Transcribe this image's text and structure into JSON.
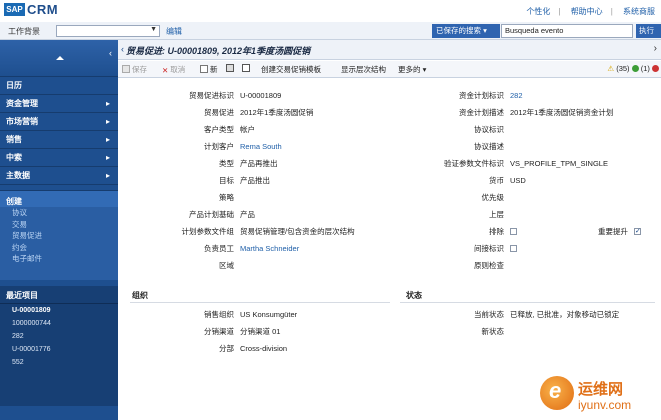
{
  "app": {
    "logo": "SAP",
    "name": "CRM"
  },
  "top_links": [
    "个性化",
    "帮助中心",
    "系统商服"
  ],
  "work_context": {
    "label": "工作背景",
    "value": "",
    "edit": "编辑"
  },
  "saved_search": {
    "label": "已保存的搜索",
    "value": "Busqueda evento",
    "execute": "执行"
  },
  "sidebar": {
    "nav": [
      {
        "label": "日历",
        "arrow": ""
      },
      {
        "label": "资金管理",
        "arrow": "▸"
      },
      {
        "label": "市场营销",
        "arrow": "▸"
      },
      {
        "label": "销售",
        "arrow": "▸"
      },
      {
        "label": "中索",
        "arrow": "▸"
      },
      {
        "label": "主数据",
        "arrow": "▸"
      }
    ],
    "create": {
      "header": "创建",
      "links": [
        "协议",
        "交易",
        "贸易促进",
        "约会",
        "电子邮件"
      ]
    },
    "recent": {
      "header": "最近项目",
      "items": [
        "U-00001809",
        "1000000744",
        "282",
        "U-00001776",
        "552"
      ]
    }
  },
  "page": {
    "title": "贸易促进: U-00001809, 2012年1季度汤圆促销",
    "toolbar": {
      "save": "保存",
      "cancel": "取消",
      "new": "新",
      "create_template": "创建交易促销模板",
      "show_hierarchy": "显示层次结构",
      "more": "更多的",
      "warn_count": "(35)",
      "ok_count": "(1)"
    }
  },
  "form": {
    "left": [
      {
        "label": "贸易促进标识",
        "value": "U-00001809",
        "link": false
      },
      {
        "label": "贸易促进",
        "value": "2012年1季度汤圆促销",
        "link": false
      },
      {
        "label": "客户类型",
        "value": "帐户",
        "link": false
      },
      {
        "label": "计划客户",
        "value": "Rema South",
        "link": true
      },
      {
        "label": "类型",
        "value": "产品再推出",
        "link": false
      },
      {
        "label": "目标",
        "value": "产品推出",
        "link": false
      },
      {
        "label": "策略",
        "value": "",
        "link": false
      },
      {
        "label": "产品计划基础",
        "value": "产品",
        "link": false
      },
      {
        "label": "计划参数文件组",
        "value": "贸易促销管理/包含资金的层次结构",
        "link": false
      },
      {
        "label": "负责员工",
        "value": "Martha Schneider",
        "link": true
      },
      {
        "label": "区域",
        "value": "",
        "link": false
      }
    ],
    "right": [
      {
        "label": "资金计划标识",
        "value": "282",
        "link": true
      },
      {
        "label": "资金计划描述",
        "value": "2012年1季度汤圆促销资金计划",
        "link": false
      },
      {
        "label": "协议标识",
        "value": "",
        "link": false
      },
      {
        "label": "协议描述",
        "value": "",
        "link": false
      },
      {
        "label": "验证参数文件标识",
        "value": "VS_PROFILE_TPM_SINGLE",
        "link": false
      },
      {
        "label": "货币",
        "value": "USD",
        "link": false
      },
      {
        "label": "优先级",
        "value": "",
        "link": false
      },
      {
        "label": "上层",
        "value": "",
        "link": false
      },
      {
        "label": "排除",
        "value": "",
        "link": false
      },
      {
        "label": "间接标识",
        "value": "",
        "link": false
      },
      {
        "label": "原则检查",
        "value": "",
        "link": false
      }
    ],
    "important_boost": {
      "label": "重要提升",
      "checked": true
    },
    "org": {
      "header": "组织",
      "fields": [
        {
          "label": "销售组织",
          "value": "US Konsumgüter"
        },
        {
          "label": "分销渠道",
          "value": "分销渠道 01"
        },
        {
          "label": "分部",
          "value": "Cross-division"
        }
      ]
    },
    "status": {
      "header": "状态",
      "fields": [
        {
          "label": "当前状态",
          "value": "已释放, 已批准，对象移动已锁定"
        },
        {
          "label": "新状态",
          "value": ""
        }
      ]
    }
  },
  "watermark": {
    "cn": "运维网",
    "url": "iyunv.com"
  }
}
